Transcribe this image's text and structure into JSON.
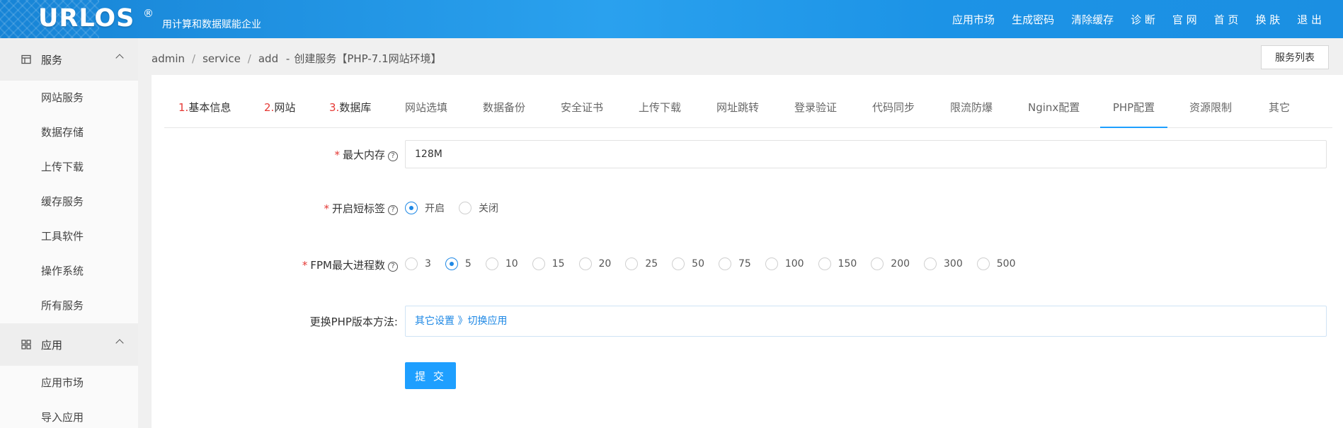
{
  "header": {
    "logo": "URLOS",
    "logo_reg": "®",
    "slogan": "用计算和数据赋能企业",
    "nav": [
      "应用市场",
      "生成密码",
      "清除缓存",
      "诊 断",
      "官 网",
      "首 页",
      "换 肤",
      "退 出"
    ]
  },
  "sidebar": {
    "groups": [
      {
        "label": "服务",
        "icon": "server-icon",
        "items": [
          "网站服务",
          "数据存储",
          "上传下载",
          "缓存服务",
          "工具软件",
          "操作系统",
          "所有服务"
        ]
      },
      {
        "label": "应用",
        "icon": "apps-grid-icon",
        "items": [
          "应用市场",
          "导入应用"
        ]
      }
    ]
  },
  "breadcrumb": {
    "parts": [
      "admin",
      "service",
      "add"
    ],
    "title_sep": "-",
    "title": "创建服务【PHP-7.1网站环境】"
  },
  "list_button": "服务列表",
  "tabs": [
    {
      "num": "1.",
      "label": "基本信息"
    },
    {
      "num": "2.",
      "label": "网站"
    },
    {
      "num": "3.",
      "label": "数据库"
    },
    {
      "num": "",
      "label": "网站选填"
    },
    {
      "num": "",
      "label": "数据备份"
    },
    {
      "num": "",
      "label": "安全证书"
    },
    {
      "num": "",
      "label": "上传下载"
    },
    {
      "num": "",
      "label": "网址跳转"
    },
    {
      "num": "",
      "label": "登录验证"
    },
    {
      "num": "",
      "label": "代码同步"
    },
    {
      "num": "",
      "label": "限流防爆"
    },
    {
      "num": "",
      "label": "Nginx配置"
    },
    {
      "num": "",
      "label": "PHP配置"
    },
    {
      "num": "",
      "label": "资源限制"
    },
    {
      "num": "",
      "label": "其它"
    }
  ],
  "active_tab": "PHP配置",
  "form": {
    "max_memory": {
      "label": "最大内存",
      "required": "*",
      "value": "128M"
    },
    "short_tag": {
      "label": "开启短标签",
      "required": "*",
      "options": [
        "开启",
        "关闭"
      ],
      "selected": "开启"
    },
    "fpm_max": {
      "label": "FPM最大进程数",
      "required": "*",
      "options": [
        "3",
        "5",
        "10",
        "15",
        "20",
        "25",
        "50",
        "75",
        "100",
        "150",
        "200",
        "300",
        "500"
      ],
      "selected": "5"
    },
    "php_switch": {
      "label": "更换PHP版本方法:",
      "value": "其它设置 》切换应用"
    },
    "submit": "提 交"
  },
  "help_glyph": "?"
}
